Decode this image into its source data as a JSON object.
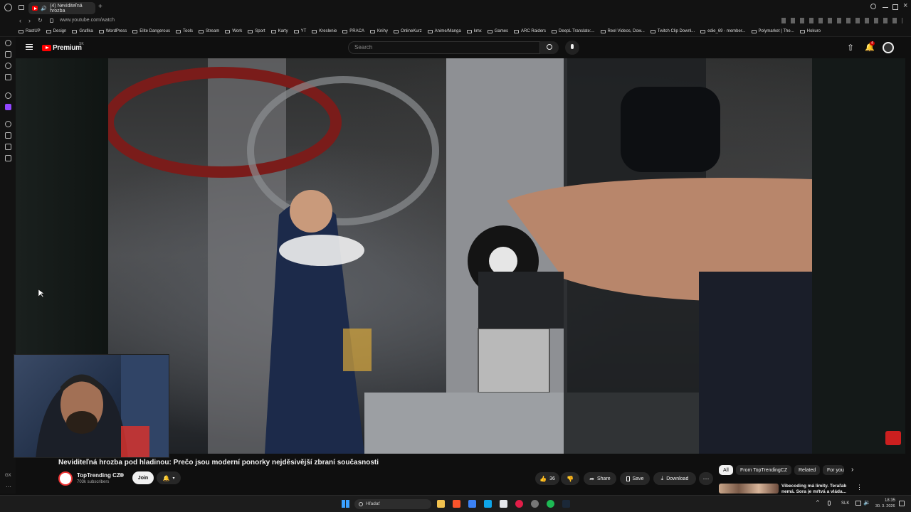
{
  "browser": {
    "tab_title": "(4) Neviditeľná hrozba",
    "url": "www.youtube.com/watch",
    "bookmarks": [
      "RastUP",
      "Design",
      "Grafika",
      "WordPress",
      "Elite Dangerous",
      "Tools",
      "Stream",
      "Work",
      "Sport",
      "Karty",
      "YT",
      "Kreslenie",
      "PRACA",
      "Knihy",
      "OnlineKurz",
      "Anime/Manga",
      "kmx",
      "Games",
      "ARC Raiders",
      "DeepL Translate:...",
      "Reel Videos, Dow...",
      "Twitch Clip Downl...",
      "edie_69 - member...",
      "Polymarket | The...",
      "Hokuro"
    ],
    "sidebar_label": "GX"
  },
  "youtube": {
    "logo_text": "Premium",
    "region": "SK",
    "search_placeholder": "Search",
    "notification_count": "4",
    "video_title": "Neviditeľná hrozba pod hladinou: Prečo jsou moderní ponorky nejděsivější zbraní současnosti",
    "channel_name": "TopTrending CZ",
    "subscribers": "703k subscribers",
    "join_label": "Join",
    "like_count": "36",
    "share_label": "Share",
    "save_label": "Save",
    "download_label": "Download",
    "chips": [
      "All",
      "From TopTrendingCZ",
      "Related",
      "For you"
    ],
    "reco_title": "Vibecoding má limity. Teraľab nemá. Sora je mŕtvá a vláda..."
  },
  "taskbar": {
    "search_placeholder": "Hľadať",
    "lang": "SLK",
    "time": "18:35",
    "date": "30. 3. 2026"
  }
}
